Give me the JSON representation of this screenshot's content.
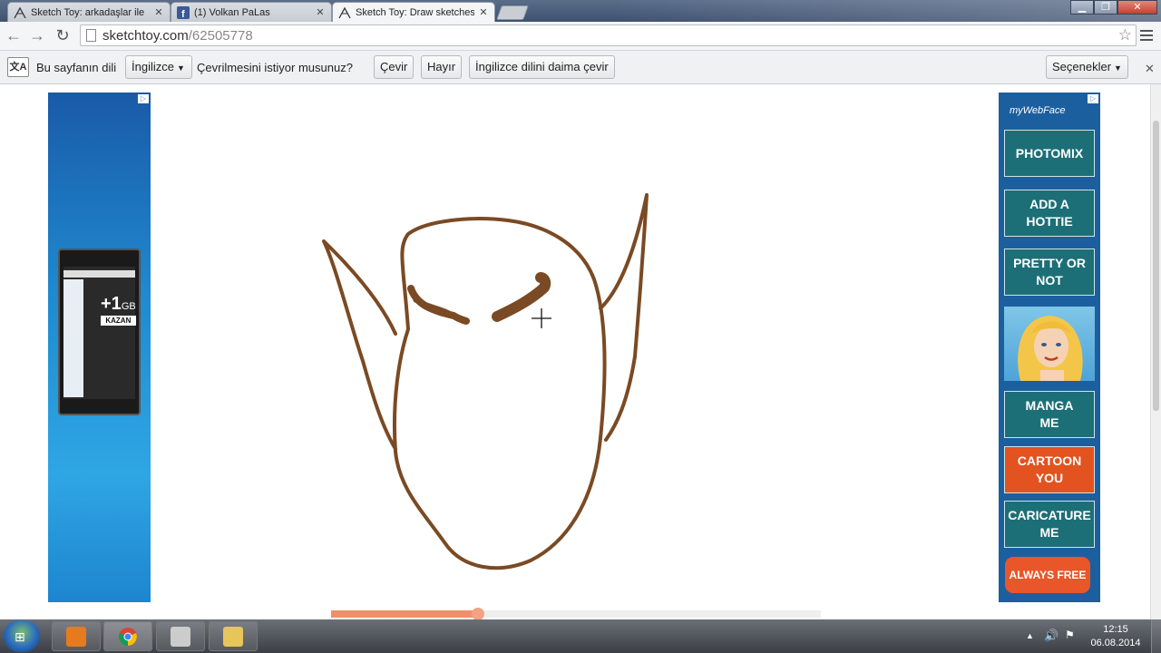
{
  "tabs": [
    {
      "title": "Sketch Toy: arkadaşlar ile",
      "favicon": "sketchtoy-icon",
      "active": false
    },
    {
      "title": "(1) Volkan PaLas",
      "favicon": "facebook-icon",
      "active": false
    },
    {
      "title": "Sketch Toy: Draw sketches",
      "favicon": "sketchtoy-icon",
      "active": true
    }
  ],
  "toolbar": {
    "url_host": "sketchtoy.com",
    "url_path": "/62505778"
  },
  "translate_bar": {
    "prefix": "Bu sayfanın dili",
    "language": "İngilizce",
    "question": "Çevrilmesini istiyor musunuz?",
    "translate_label": "Çevir",
    "no_label": "Hayır",
    "always_label": "İngilizce dilini daima çevir",
    "options_label": "Seçenekler"
  },
  "ad_left": {
    "promo_big": "+1",
    "promo_unit": "GB",
    "promo_action": "KAZAN"
  },
  "ad_right": {
    "logo": "myWebFace",
    "items": [
      {
        "label_1": "PHOTOMIX",
        "label_2": ""
      },
      {
        "label_1": "ADD A",
        "label_2": "HOTTIE"
      },
      {
        "label_1": "PRETTY OR",
        "label_2": "NOT"
      },
      {
        "label_1": "MANGA",
        "label_2": "ME"
      },
      {
        "label_1": "CARTOON",
        "label_2": "YOU"
      },
      {
        "label_1": "CARICATURE",
        "label_2": "ME"
      }
    ],
    "free_label": "ALWAYS FREE"
  },
  "sketch": {
    "stroke_color": "#7a4a24",
    "playback_progress": 0.3
  },
  "taskbar": {
    "time": "12:15",
    "date": "06.08.2014"
  }
}
